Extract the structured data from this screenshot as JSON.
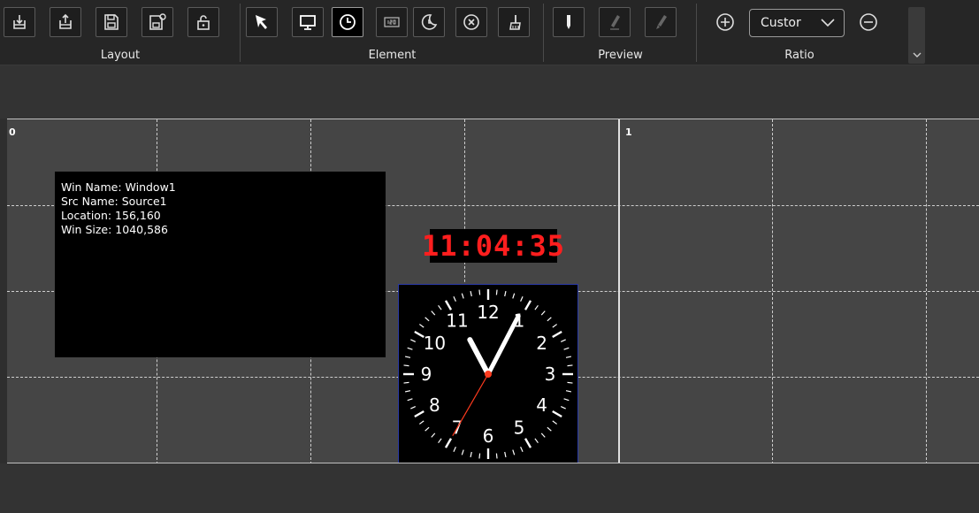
{
  "toolbar": {
    "groups": {
      "layout": {
        "label": "Layout"
      },
      "element": {
        "label": "Element"
      },
      "preview": {
        "label": "Preview"
      },
      "ratio": {
        "label": "Ratio",
        "select_value": "Custor"
      }
    }
  },
  "canvas": {
    "screen_labels": [
      "0",
      "1"
    ],
    "window": {
      "win_name": "Win Name:  Window1",
      "src_name": "Src Name:  Source1",
      "location": "Location:  156,160",
      "win_size": "Win Size:  1040,586"
    },
    "digital_clock": {
      "time": "11:04:35"
    },
    "analog_clock": {
      "numbers": [
        "12",
        "1",
        "2",
        "3",
        "4",
        "5",
        "6",
        "7",
        "8",
        "9",
        "10",
        "11"
      ]
    }
  },
  "colors": {
    "digital": "#ff1e1e",
    "second_hand": "#ff3b1e",
    "clock_border": "#2a3aa8"
  }
}
